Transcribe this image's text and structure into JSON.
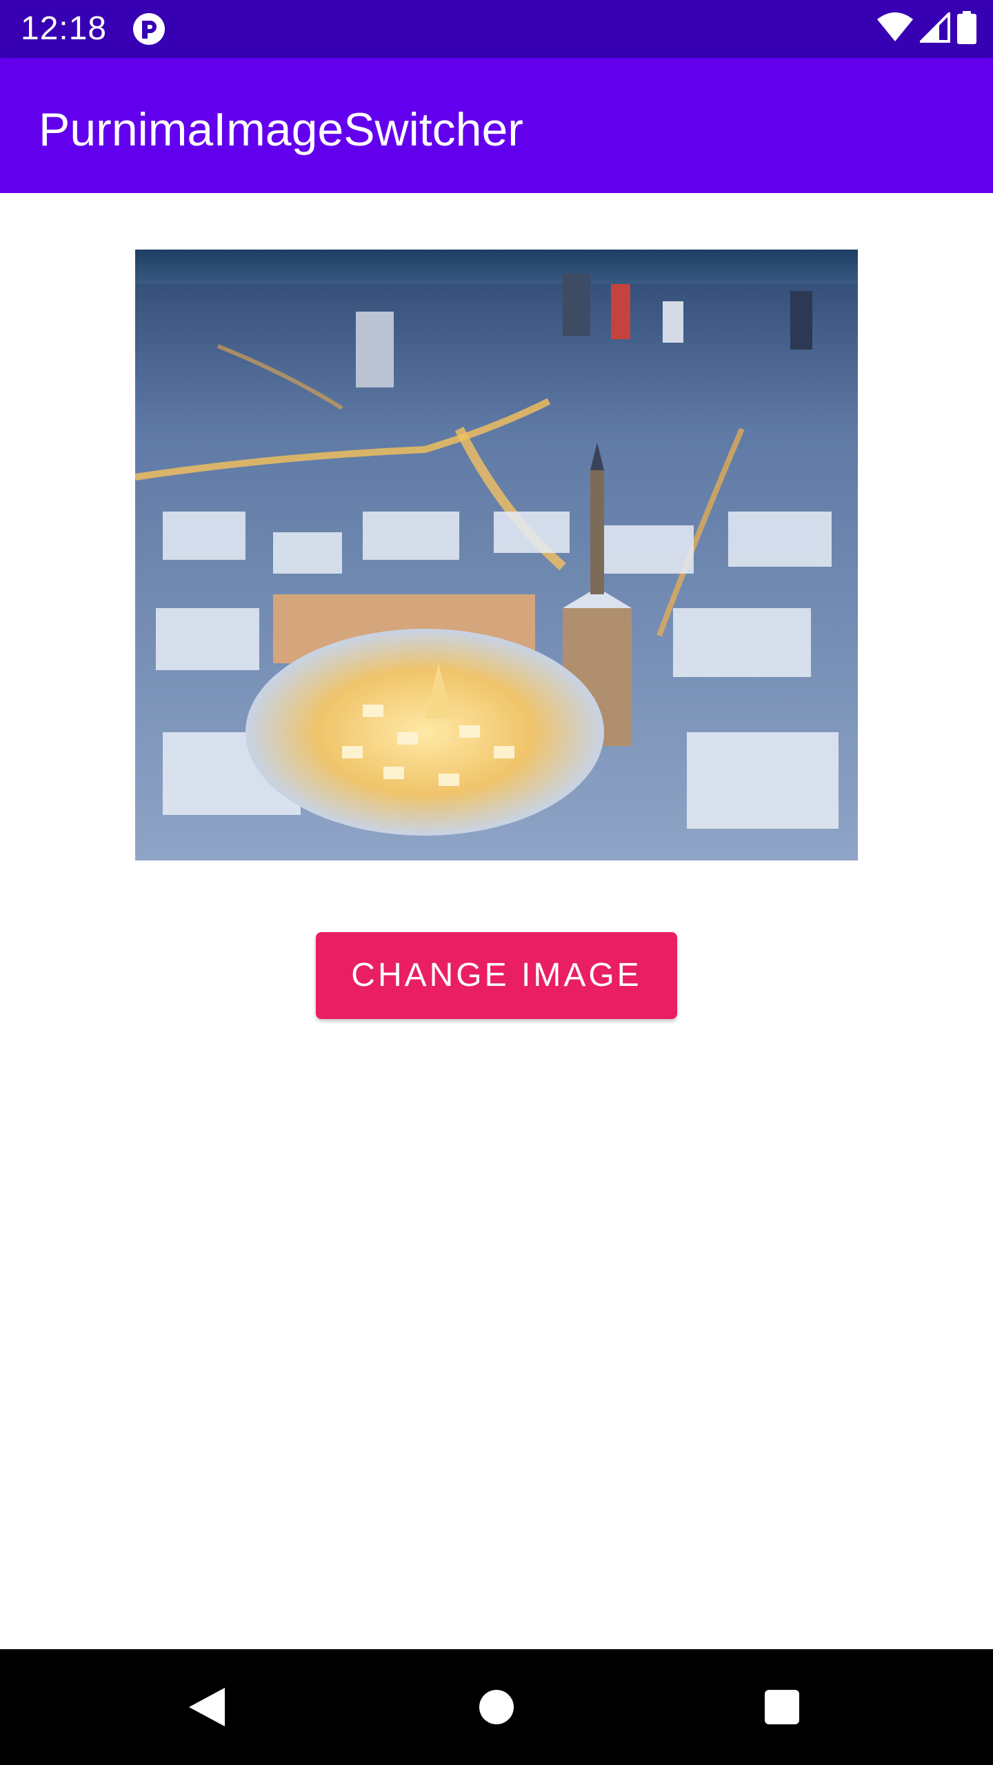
{
  "status_bar": {
    "time": "12:18",
    "background": "#3700B3",
    "icons": [
      "app-notification-icon",
      "wifi-icon",
      "cellular-signal-icon",
      "battery-icon"
    ]
  },
  "app_bar": {
    "title": "PurnimaImageSwitcher",
    "background": "#6200EE"
  },
  "main": {
    "image": {
      "description_icon": "city-photo-image"
    },
    "button": {
      "label": "CHANGE IMAGE",
      "color": "#E91E63"
    }
  },
  "nav_bar": {
    "icons": [
      "back-icon",
      "home-icon",
      "recents-icon"
    ]
  }
}
